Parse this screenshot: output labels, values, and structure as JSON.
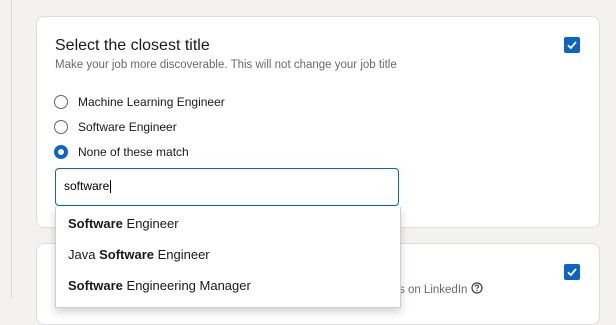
{
  "card1": {
    "title": "Select the closest title",
    "subtitle": "Make your job more discoverable. This will not change your job title",
    "options": [
      {
        "label": "Machine Learning Engineer",
        "selected": false
      },
      {
        "label": "Software Engineer",
        "selected": false
      },
      {
        "label": "None of these match",
        "selected": true
      }
    ],
    "input_value": "software",
    "checked": true
  },
  "dropdown": {
    "items": [
      {
        "bold_pre": "",
        "pre": "",
        "bold": "Software",
        "post": " Engineer"
      },
      {
        "pre": "Java ",
        "bold": "Software",
        "post": " Engineer"
      },
      {
        "pre": "",
        "bold": "Software",
        "post": " Engineering Manager"
      }
    ]
  },
  "card2": {
    "text_partial": "s on LinkedIn",
    "checked": true
  },
  "colors": {
    "accent": "#0a66c2"
  }
}
